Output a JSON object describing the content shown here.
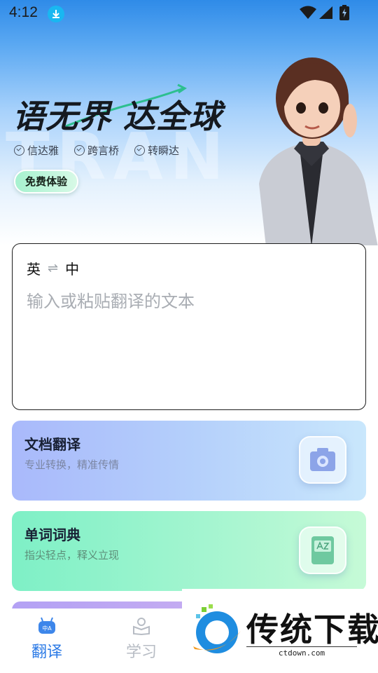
{
  "status_bar": {
    "time": "4:12"
  },
  "hero": {
    "watermark": "TRAN",
    "headline": "语无界 达全球",
    "tags": [
      "信达雅",
      "跨言桥",
      "转瞬达"
    ],
    "trial_button": "免费体验"
  },
  "translator": {
    "source_lang": "英",
    "swap_symbol": "⇌",
    "target_lang": "中",
    "placeholder": "输入或粘贴翻译的文本"
  },
  "features": [
    {
      "title": "文档翻译",
      "subtitle": "专业转换，精准传情"
    },
    {
      "title": "单词词典",
      "subtitle": "指尖轻点，释义立现"
    }
  ],
  "nav": {
    "items": [
      {
        "label": "翻译",
        "active": true
      },
      {
        "label": "学习",
        "active": false
      }
    ]
  },
  "brand_overlay": {
    "name": "传统下载",
    "url": "ctdown.com"
  },
  "colors": {
    "accent": "#2d7be6",
    "doc_card": "#b4cffb",
    "dict_card": "#a4f5d0",
    "trial_button": "#a7f2cf"
  }
}
